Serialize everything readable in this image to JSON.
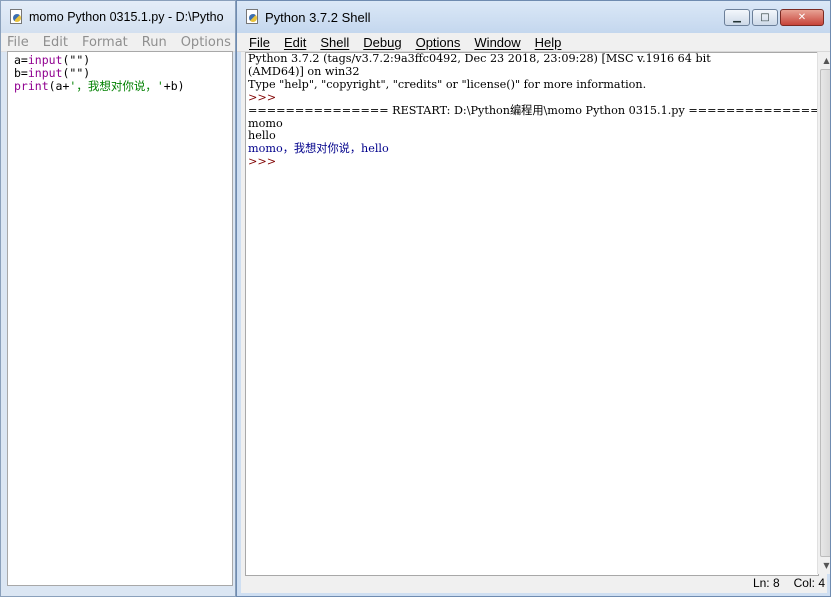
{
  "editor": {
    "title": "momo Python 0315.1.py - D:\\Pytho",
    "menu": [
      "File",
      "Edit",
      "Format",
      "Run",
      "Options"
    ],
    "code": [
      [
        {
          "t": "a=",
          "c": "def"
        },
        {
          "t": "input",
          "c": "kw"
        },
        {
          "t": "(\"\")",
          "c": "def"
        }
      ],
      [
        {
          "t": "b=",
          "c": "def"
        },
        {
          "t": "input",
          "c": "kw"
        },
        {
          "t": "(\"\")",
          "c": "def"
        }
      ],
      [
        {
          "t": "print",
          "c": "kw"
        },
        {
          "t": "(a+",
          "c": "def"
        },
        {
          "t": "'，我想对你说，'",
          "c": "str"
        },
        {
          "t": "+b)",
          "c": "def"
        }
      ]
    ]
  },
  "shell": {
    "title": "Python 3.7.2 Shell",
    "menu": [
      "File",
      "Edit",
      "Shell",
      "Debug",
      "Options",
      "Window",
      "Help"
    ],
    "lines": [
      [
        {
          "t": "Python 3.7.2 (tags/v3.7.2:9a3ffc0492, Dec 23 2018, 23:09:28) [MSC v.1916 64 bit",
          "c": "def"
        }
      ],
      [
        {
          "t": "(AMD64)] on win32",
          "c": "def"
        }
      ],
      [
        {
          "t": "Type \"help\", \"copyright\", \"credits\" or \"license()\" for more information.",
          "c": "def"
        }
      ],
      [
        {
          "t": ">>> ",
          "c": "prompt"
        }
      ],
      [
        {
          "t": "=============== RESTART: D:\\Python编程用\\momo Python 0315.1.py ===============",
          "c": "def"
        }
      ],
      [
        {
          "t": "momo",
          "c": "def"
        }
      ],
      [
        {
          "t": "hello",
          "c": "def"
        }
      ],
      [
        {
          "t": "momo，我想对你说，hello",
          "c": "out"
        }
      ],
      [
        {
          "t": ">>> ",
          "c": "prompt"
        }
      ]
    ],
    "status": {
      "line": "Ln: 8",
      "col": "Col: 4"
    }
  },
  "colors": {
    "keyword": "#900090",
    "string": "#008000",
    "output": "#00008b",
    "prompt": "#7f0000"
  }
}
